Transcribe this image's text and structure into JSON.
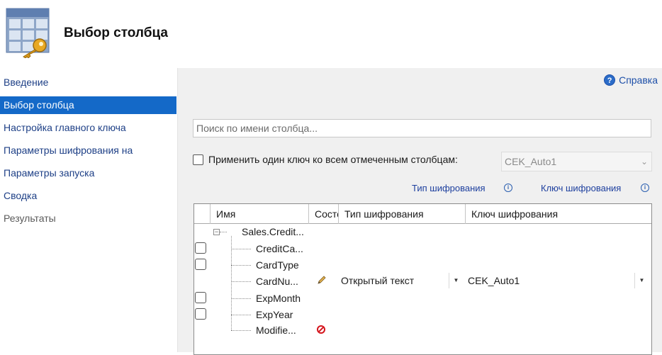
{
  "header": {
    "title": "Выбор столбца",
    "icon": "table-key-icon"
  },
  "sidebar": {
    "items": [
      {
        "label": "Введение"
      },
      {
        "label": "Выбор столбца"
      },
      {
        "label": "Настройка главного ключа"
      },
      {
        "label": "Параметры шифрования на"
      },
      {
        "label": "Параметры запуска"
      },
      {
        "label": "Сводка"
      },
      {
        "label": "Результаты"
      }
    ],
    "active_index": 1,
    "active_color": "#1469c8"
  },
  "main": {
    "help_label": "Справка",
    "search_placeholder": "Поиск по имени столбца...",
    "apply_one_key_label": "Применить один ключ ко всем отмеченным столбцам:",
    "apply_key_value": "CEK_Auto1",
    "encryption_type_link": "Тип шифрования",
    "encryption_key_link": "Ключ шифрования"
  },
  "grid": {
    "columns": [
      "Имя",
      "Состо",
      "Тип шифрования",
      "Ключ шифрования"
    ],
    "table_name": "Sales.Credit...",
    "rows": [
      {
        "name": "CreditCa...",
        "state_icon": "",
        "enc_type": "",
        "enc_key": ""
      },
      {
        "name": "CardType",
        "state_icon": "",
        "enc_type": "",
        "enc_key": ""
      },
      {
        "name": "CardNu...",
        "state_icon": "pencil-icon",
        "enc_type": "Открытый текст",
        "enc_key": "CEK_Auto1"
      },
      {
        "name": "ExpMonth",
        "state_icon": "",
        "enc_type": "",
        "enc_key": ""
      },
      {
        "name": "ExpYear",
        "state_icon": "",
        "enc_type": "",
        "enc_key": ""
      },
      {
        "name": "Modifie...",
        "state_icon": "no-entry-icon",
        "enc_type": "",
        "enc_key": ""
      }
    ]
  }
}
